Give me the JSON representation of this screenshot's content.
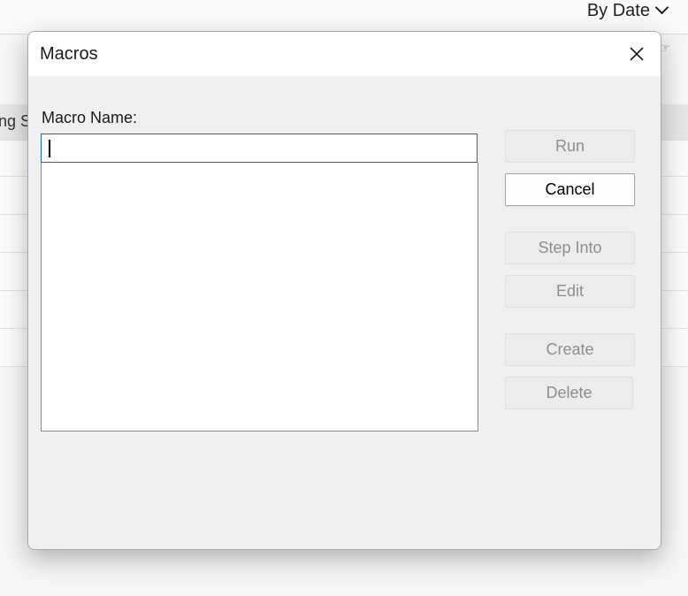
{
  "background": {
    "sort_label": "By Date",
    "header_fragment": "ng S"
  },
  "dialog": {
    "title": "Macros",
    "macro_name_label": "Macro Name:",
    "macro_name_value": "",
    "macro_list_items": [],
    "buttons": {
      "run": "Run",
      "cancel": "Cancel",
      "step_into": "Step Into",
      "edit": "Edit",
      "create": "Create",
      "delete": "Delete"
    }
  },
  "colors": {
    "focus_border": "#0f6cbd",
    "dialog_bg": "#f0f0f0",
    "disabled_text": "#8f8f8f"
  }
}
